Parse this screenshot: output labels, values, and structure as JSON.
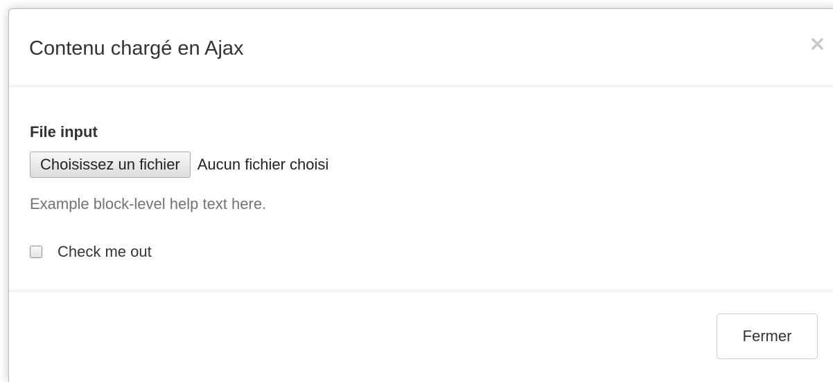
{
  "modal": {
    "title": "Contenu chargé en Ajax",
    "close_symbol": "×"
  },
  "form": {
    "file_label": "File input",
    "file_button_label": "Choisissez un fichier",
    "file_status": "Aucun fichier choisi",
    "help_text": "Example block-level help text here.",
    "checkbox_label": "Check me out",
    "checkbox_checked": false
  },
  "footer": {
    "close_button_label": "Fermer"
  },
  "icons": {
    "close": "close-icon"
  }
}
